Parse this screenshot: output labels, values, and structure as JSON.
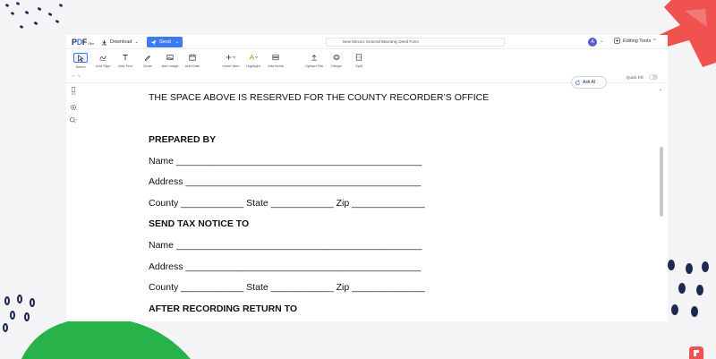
{
  "app": {
    "logo": {
      "prefix": "P",
      "accent": "D",
      "suffix": "F",
      "edition": "Filler"
    },
    "download_label": "Download",
    "send_label": "Send",
    "document_name": "New Mexico General Warranty Deed Form",
    "avatar_initial": "A",
    "editing_tools_label": "Editing Tools",
    "quick_fill_label": "Quick Fill"
  },
  "toolbar": {
    "items": [
      {
        "label": "Select",
        "icon": "cursor-icon"
      },
      {
        "label": "Add Sign",
        "icon": "sign-icon"
      },
      {
        "label": "Add Text",
        "icon": "text-icon"
      },
      {
        "label": "Draw",
        "icon": "pen-icon"
      },
      {
        "label": "Add Image",
        "icon": "image-icon"
      },
      {
        "label": "Add Date",
        "icon": "calendar-icon"
      },
      {
        "label": "Insert Item",
        "icon": "plus-icon"
      },
      {
        "label": "Highlight",
        "icon": "highlight-icon"
      },
      {
        "label": "Add fields",
        "icon": "fields-icon"
      },
      {
        "label": "Upload File",
        "icon": "upload-icon"
      },
      {
        "label": "Merge",
        "icon": "merge-icon"
      },
      {
        "label": "Split",
        "icon": "split-icon"
      }
    ]
  },
  "sidebar": {
    "items": [
      {
        "label": "1/3",
        "icon": "page-icon"
      },
      {
        "icon": "settings-icon"
      },
      {
        "icon": "zoom-icon"
      }
    ]
  },
  "document": {
    "lines": [
      {
        "text": "THE SPACE ABOVE IS RESERVED FOR THE COUNTY RECORDER’S OFFICE",
        "bold": false
      },
      {
        "text": "PREPARED BY",
        "bold": true
      },
      {
        "text": "Name _______________________________________________",
        "bold": false
      },
      {
        "text": "Address _____________________________________________",
        "bold": false
      },
      {
        "text": "County ____________ State ____________ Zip ______________",
        "bold": false
      },
      {
        "text": "SEND TAX NOTICE TO",
        "bold": true
      },
      {
        "text": "Name _______________________________________________",
        "bold": false
      },
      {
        "text": "Address _____________________________________________",
        "bold": false
      },
      {
        "text": "County ____________ State ____________ Zip ______________",
        "bold": false
      },
      {
        "text": "AFTER RECORDING RETURN TO",
        "bold": true
      }
    ]
  },
  "ask_ai_label": "Ask AI",
  "colors": {
    "accent": "#3d7bf6",
    "red_deco": "#f0524f",
    "green_deco": "#27b24a",
    "navy_deco": "#1b2a4e"
  }
}
